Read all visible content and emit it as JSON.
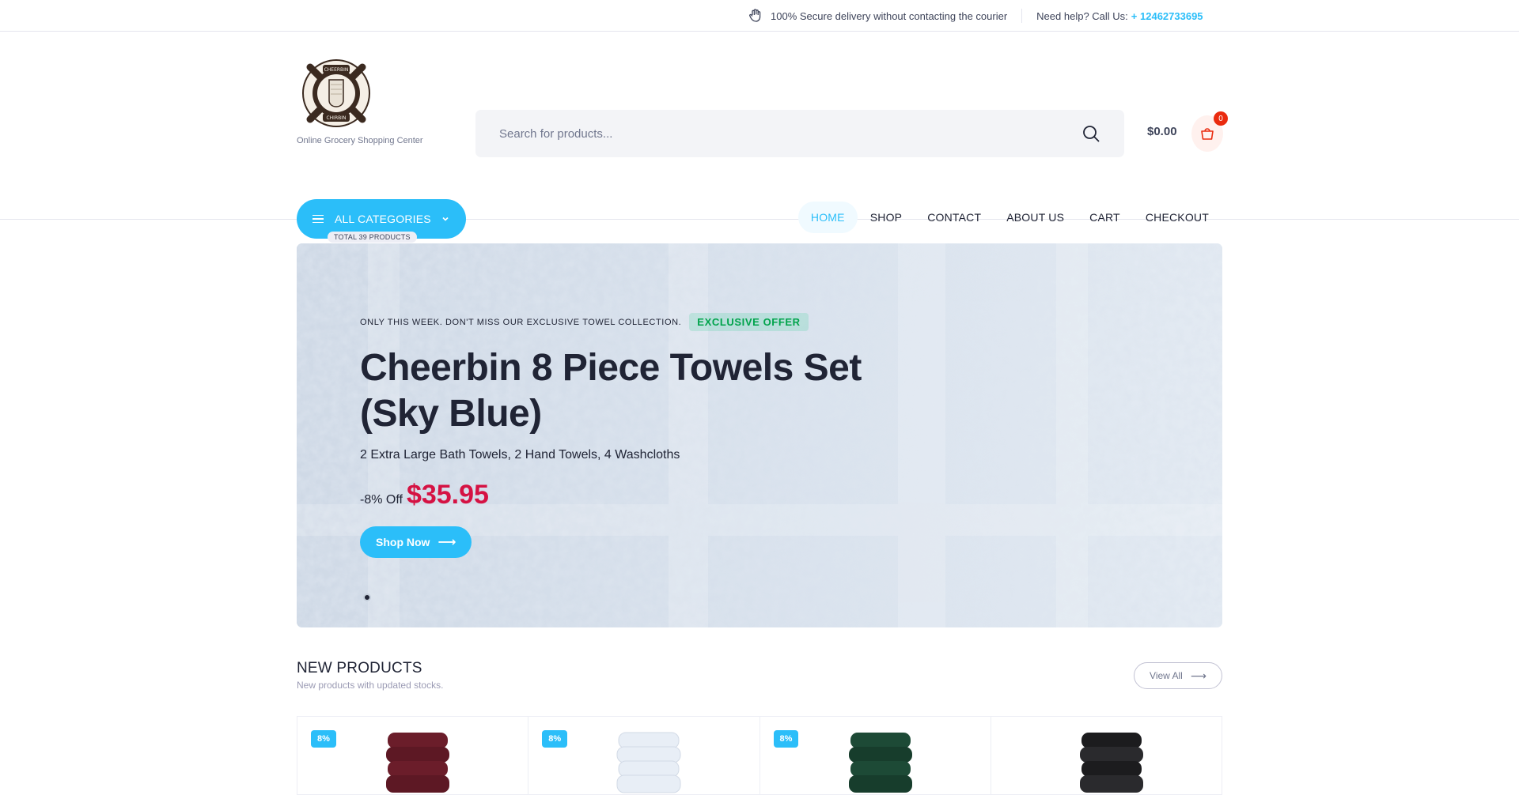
{
  "topbar": {
    "delivery_text": "100% Secure delivery without contacting the courier",
    "help_text": "Need help? Call Us:",
    "phone": "+ 12462733695"
  },
  "header": {
    "logo_top_text": "CHEERBIN",
    "logo_bottom_text": "CHIRBIN",
    "tagline": "Online Grocery Shopping Center",
    "search_placeholder": "Search for products...",
    "cart_total": "$0.00",
    "cart_count": "0",
    "all_categories_label": "ALL CATEGORIES",
    "total_products": "TOTAL 39 PRODUCTS"
  },
  "nav": {
    "items": [
      {
        "label": "HOME",
        "active": true
      },
      {
        "label": "SHOP",
        "active": false
      },
      {
        "label": "CONTACT",
        "active": false
      },
      {
        "label": "ABOUT US",
        "active": false
      },
      {
        "label": "CART",
        "active": false
      },
      {
        "label": "CHECKOUT",
        "active": false
      }
    ]
  },
  "hero": {
    "kicker": "ONLY THIS WEEK. DON'T MISS OUR EXCLUSIVE TOWEL COLLECTION.",
    "offer_badge": "EXCLUSIVE OFFER",
    "title": "Cheerbin 8 Piece Towels Set (Sky Blue)",
    "subtitle": "2 Extra Large Bath Towels, 2 Hand Towels, 4 Washcloths",
    "discount_text": "-8% Off",
    "price": "$35.95",
    "cta_label": "Shop Now"
  },
  "new_products": {
    "title": "NEW PRODUCTS",
    "subtitle": "New products with updated stocks.",
    "view_all_label": "View All",
    "items": [
      {
        "discount": "8%",
        "color": "#6b1d2a"
      },
      {
        "discount": "8%",
        "color": "#e8eef6"
      },
      {
        "discount": "8%",
        "color": "#1d4a36"
      },
      {
        "discount": "",
        "color": "#1c1c1e"
      }
    ]
  },
  "colors": {
    "accent": "#2bbef9",
    "price": "#d51243",
    "offer_green": "#00a34b",
    "cart_badge": "#ea2b0f"
  }
}
